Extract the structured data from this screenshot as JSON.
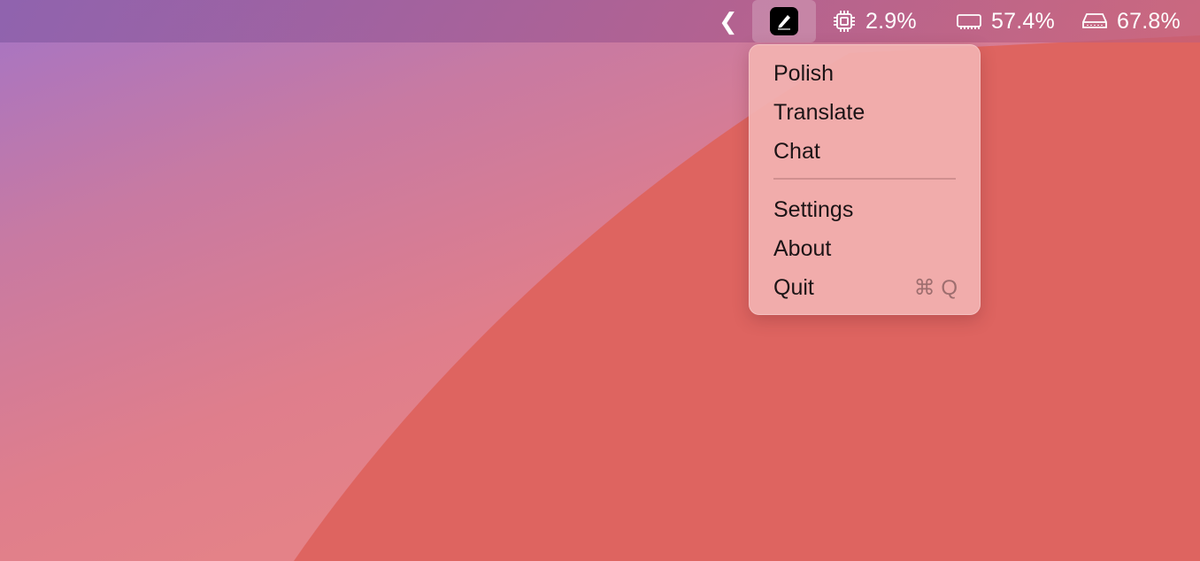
{
  "menubar": {
    "chevron": "❮",
    "app_icon": "pen-icon",
    "cpu": {
      "icon": "cpu-chip-icon",
      "value": "2.9%"
    },
    "memory": {
      "icon": "memory-icon",
      "value": "57.4%"
    },
    "disk": {
      "icon": "disk-drive-icon",
      "value": "67.8%"
    }
  },
  "menu": {
    "items": [
      {
        "label": "Polish"
      },
      {
        "label": "Translate"
      },
      {
        "label": "Chat"
      },
      {
        "label": "Settings"
      },
      {
        "label": "About"
      },
      {
        "label": "Quit",
        "shortcut": "⌘ Q"
      }
    ]
  },
  "colors": {
    "menu_background": "#f2b2b0",
    "desktop_wave": "#de6460",
    "menubar_tint": "#a8609a"
  }
}
